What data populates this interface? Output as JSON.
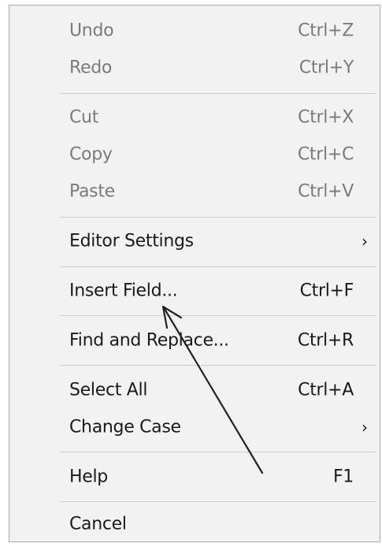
{
  "menu": {
    "items": [
      {
        "label": "Undo",
        "shortcut": "Ctrl+Z"
      },
      {
        "label": "Redo",
        "shortcut": "Ctrl+Y"
      },
      {
        "label": "Cut",
        "shortcut": "Ctrl+X"
      },
      {
        "label": "Copy",
        "shortcut": "Ctrl+C"
      },
      {
        "label": "Paste",
        "shortcut": "Ctrl+V"
      },
      {
        "label": "Editor Settings",
        "submenu_icon": "chevron-right-icon",
        "glyph": "›"
      },
      {
        "label": "Insert Field...",
        "shortcut": "Ctrl+F"
      },
      {
        "label": "Find and Replace...",
        "shortcut": "Ctrl+R"
      },
      {
        "label": "Select All",
        "shortcut": "Ctrl+A"
      },
      {
        "label": "Change Case",
        "submenu_icon": "chevron-right-icon",
        "glyph": "›"
      },
      {
        "label": "Help",
        "shortcut": "F1"
      },
      {
        "label": "Cancel"
      }
    ]
  },
  "annotation": {
    "icon": "pointer-arrow-icon",
    "color": "#222222"
  },
  "colors": {
    "menu_background": "#f2f2f2",
    "disabled_text": "#7a7a7a",
    "enabled_text": "#1a1a1a",
    "separator": "#cfcfcf"
  }
}
